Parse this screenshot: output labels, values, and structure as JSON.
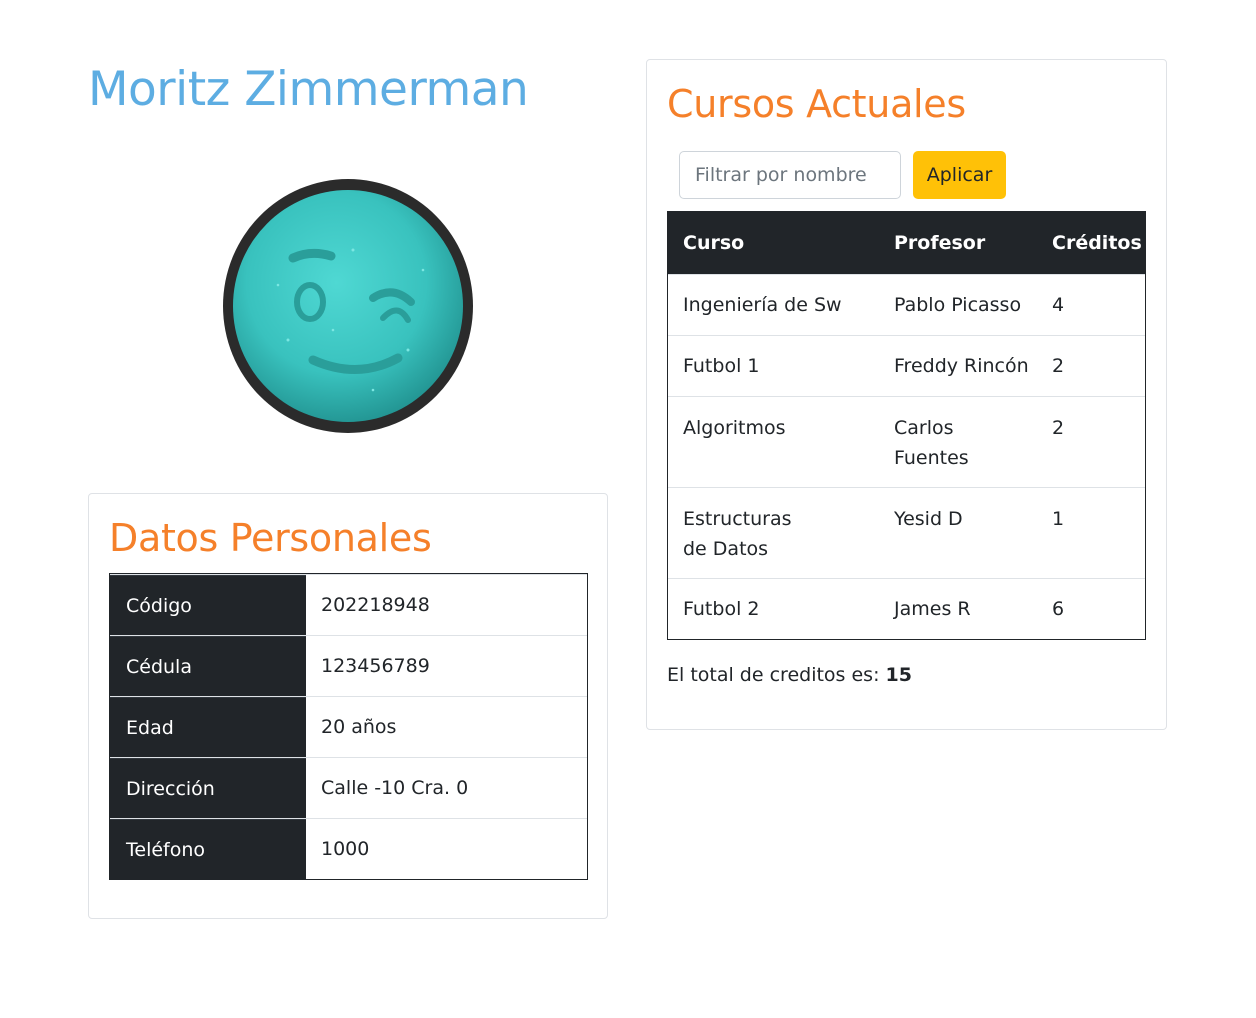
{
  "student": {
    "name": "Moritz Zimmerman"
  },
  "personal": {
    "title": "Datos Personales",
    "rows": [
      {
        "label": "Código",
        "value": "202218948"
      },
      {
        "label": "Cédula",
        "value": "123456789"
      },
      {
        "label": "Edad",
        "value": "20 años"
      },
      {
        "label": "Dirección",
        "value": "Calle -10 Cra. 0"
      },
      {
        "label": "Teléfono",
        "value": "1000"
      }
    ]
  },
  "courses": {
    "title": "Cursos Actuales",
    "filter_placeholder": "Filtrar por nombre",
    "apply_label": "Aplicar",
    "headers": {
      "course": "Curso",
      "professor": "Profesor",
      "credits": "Créditos"
    },
    "rows": [
      {
        "course": "Ingeniería de Sw",
        "professor": "Pablo Picasso",
        "credits": "4"
      },
      {
        "course": "Futbol 1",
        "professor": "Freddy Rincón",
        "credits": "2"
      },
      {
        "course": "Algoritmos",
        "professor": "Carlos Fuentes",
        "credits": "2"
      },
      {
        "course": "Estructuras de Datos",
        "professor": "Yesid D",
        "credits": "1"
      },
      {
        "course": "Futbol 2",
        "professor": "James R",
        "credits": "6"
      }
    ],
    "total_label": "El total de creditos es:",
    "total_value": "15"
  },
  "colors": {
    "name": "#5dade2",
    "section_title": "#f5802a",
    "table_dark": "#212529",
    "apply_button": "#ffc107"
  }
}
